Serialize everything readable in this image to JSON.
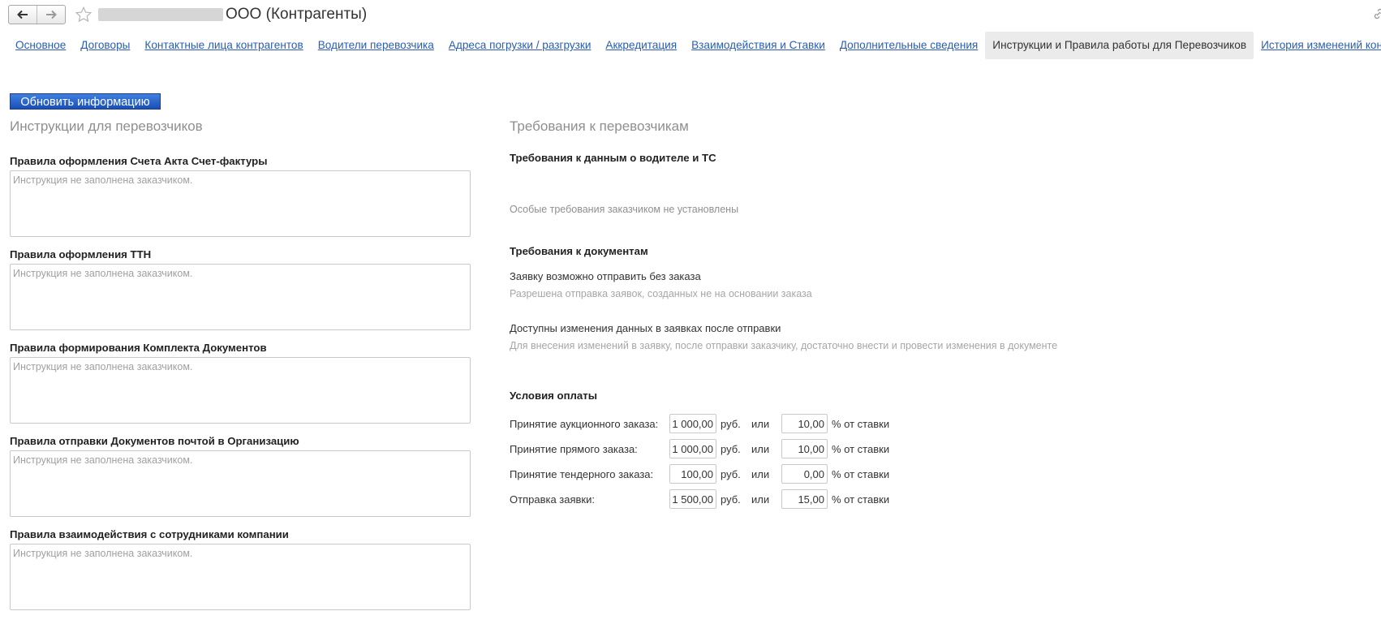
{
  "header": {
    "title": "ООО (Контрагенты)",
    "back_icon": "arrow-left-icon",
    "forward_icon": "arrow-right-icon",
    "favorite_icon": "star-icon",
    "link_icon": "link-icon"
  },
  "tabs": [
    {
      "label": "Основное",
      "active": false
    },
    {
      "label": "Договоры",
      "active": false
    },
    {
      "label": "Контактные лица контрагентов",
      "active": false
    },
    {
      "label": "Водители перевозчика",
      "active": false
    },
    {
      "label": "Адреса погрузки / разгрузки",
      "active": false
    },
    {
      "label": "Аккредитация",
      "active": false
    },
    {
      "label": "Взаимодействия и Ставки",
      "active": false
    },
    {
      "label": "Дополнительные сведения",
      "active": false
    },
    {
      "label": "Инструкции и Правила работы для Перевозчиков",
      "active": true
    },
    {
      "label": "История изменений контрагента",
      "active": false
    }
  ],
  "refresh_button": "Обновить информацию",
  "instructions": {
    "title": "Инструкции для перевозчиков",
    "items": [
      {
        "label": "Правила оформления Счета Акта Счет-фактуры",
        "placeholder": "Инструкция не заполнена заказчиком."
      },
      {
        "label": "Правила оформления ТТН",
        "placeholder": "Инструкция не заполнена заказчиком."
      },
      {
        "label": "Правила формирования Комплекта Документов",
        "placeholder": "Инструкция не заполнена заказчиком."
      },
      {
        "label": "Правила отправки Документов почтой в Организацию",
        "placeholder": "Инструкция не заполнена заказчиком."
      },
      {
        "label": "Правила взаимодействия с сотрудниками компании",
        "placeholder": "Инструкция не заполнена заказчиком."
      }
    ]
  },
  "requirements": {
    "title": "Требования к перевозчикам",
    "driver_heading": "Требования к данным о водителе и ТС",
    "driver_text": "Особые требования заказчиком не установлены",
    "docs_heading": "Требования к документам",
    "docs_item1_title": "Заявку возможно отправить без заказа",
    "docs_item1_desc": "Разрешена отправка заявок, созданных не на основании заказа",
    "docs_item2_title": "Доступны изменения данных в заявках после отправки",
    "docs_item2_desc": "Для внесения изменений в заявку, после отправки заказчику, достаточно внести и провести изменения в документе",
    "payment_heading": "Условия оплаты",
    "payment_rows": [
      {
        "label": "Принятие аукционного заказа:",
        "amount": "1 000,00",
        "currency": "руб.",
        "or": "или",
        "percent": "10,00",
        "percent_label": "% от ставки"
      },
      {
        "label": "Принятие прямого заказа:",
        "amount": "1 000,00",
        "currency": "руб.",
        "or": "или",
        "percent": "10,00",
        "percent_label": "% от ставки"
      },
      {
        "label": "Принятие тендерного заказа:",
        "amount": "100,00",
        "currency": "руб.",
        "or": "или",
        "percent": "0,00",
        "percent_label": "% от ставки"
      },
      {
        "label": "Отправка заявки:",
        "amount": "1 500,00",
        "currency": "руб.",
        "or": "или",
        "percent": "15,00",
        "percent_label": "% от ставки"
      }
    ]
  }
}
